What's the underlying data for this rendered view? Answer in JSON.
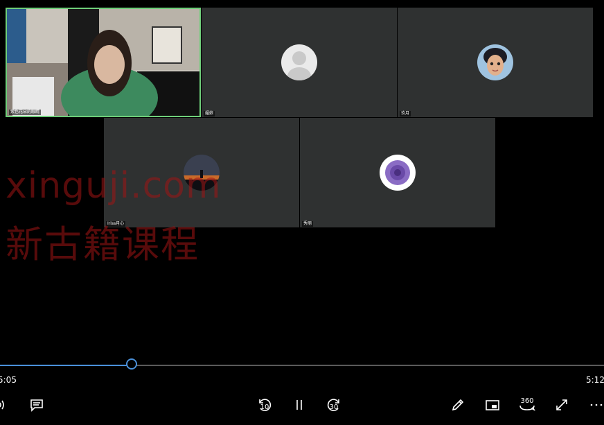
{
  "participants": [
    {
      "name": "紫色花朵的眼睛",
      "video": true,
      "active": true
    },
    {
      "name": "媚娘",
      "video": false
    },
    {
      "name": "玖月",
      "video": false
    },
    {
      "name": "Iriss月心",
      "video": false
    },
    {
      "name": "秀丽",
      "video": false
    }
  ],
  "watermark": {
    "line1": "xinguji.com",
    "line2": "新古籍课程"
  },
  "player": {
    "current_time": "5:05",
    "total_time": "5:12:",
    "progress": 0.218,
    "skip_back_label": "10",
    "skip_forward_label": "30",
    "vr_label": "360"
  },
  "colors": {
    "accent": "#4a90d9",
    "active_speaker": "#6fcf7a",
    "tile_bg": "#2f3131",
    "watermark": "#a01414"
  },
  "icons": [
    "volume-icon",
    "subtitles-icon",
    "skip-back-10-icon",
    "pause-icon",
    "skip-forward-30-icon",
    "pen-icon",
    "mini-view-icon",
    "vr-360-icon",
    "fullscreen-icon",
    "more-icon"
  ]
}
